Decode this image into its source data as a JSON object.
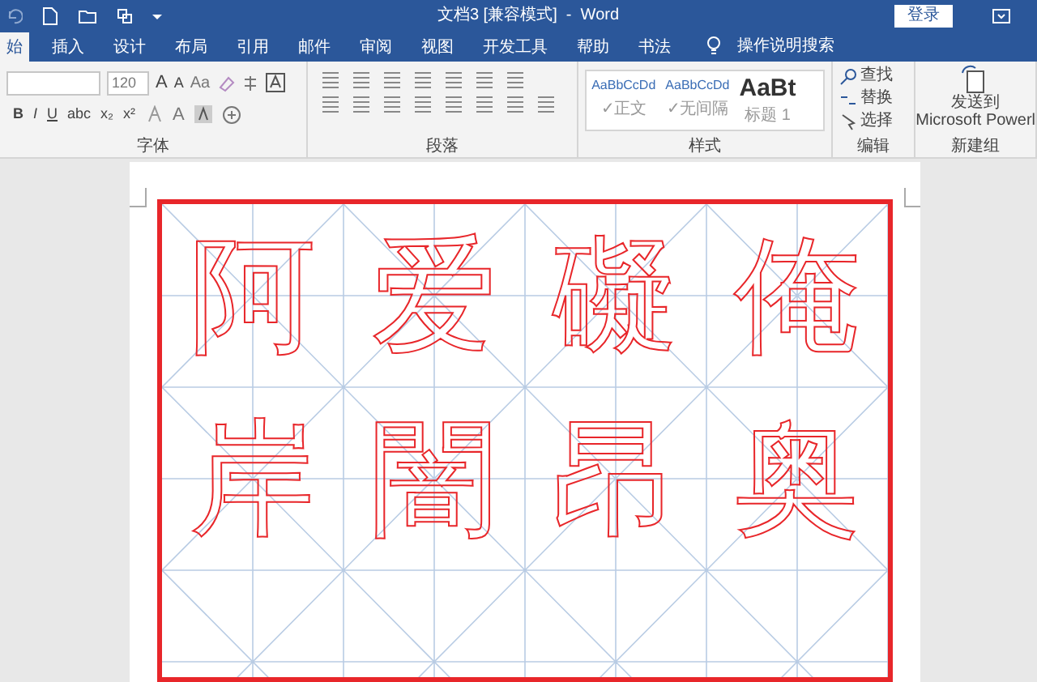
{
  "window": {
    "title": "文档3 [兼容模式]  -  Word",
    "sign_in": "登录"
  },
  "tabs": [
    {
      "label": "始",
      "selected": true
    },
    {
      "label": "插入",
      "selected": false
    },
    {
      "label": "设计",
      "selected": false
    },
    {
      "label": "布局",
      "selected": false
    },
    {
      "label": "引用",
      "selected": false
    },
    {
      "label": "邮件",
      "selected": false
    },
    {
      "label": "审阅",
      "selected": false
    },
    {
      "label": "视图",
      "selected": false
    },
    {
      "label": "开发工具",
      "selected": false
    },
    {
      "label": "帮助",
      "selected": false
    },
    {
      "label": "书法",
      "selected": false
    }
  ],
  "tell_me": "操作说明搜索",
  "ribbon": {
    "font_size": "120",
    "font_buttons": [
      "B",
      "I",
      "U",
      "abc",
      "x₂",
      "x²"
    ],
    "grow": "A",
    "shrink": "A",
    "case": "Aa",
    "font_color": "A",
    "styles": [
      {
        "preview": "AaBbCcDd",
        "name": "✓正文",
        "kind": "small"
      },
      {
        "preview": "AaBbCcDd",
        "name": "✓无间隔",
        "kind": "small"
      },
      {
        "preview": "AaBt",
        "name": "标题 1",
        "kind": "large"
      }
    ],
    "editing": [
      "查找",
      "替换",
      "选择"
    ],
    "send": [
      "发送到",
      "Microsoft Powerl"
    ],
    "groups": [
      "字体",
      "段落",
      "样式",
      "编辑",
      "新建组"
    ]
  },
  "grid": {
    "rows": [
      [
        "阿",
        "爱",
        "礙",
        "俺"
      ],
      [
        "岸",
        "闇",
        "昂",
        "奥"
      ],
      []
    ]
  }
}
